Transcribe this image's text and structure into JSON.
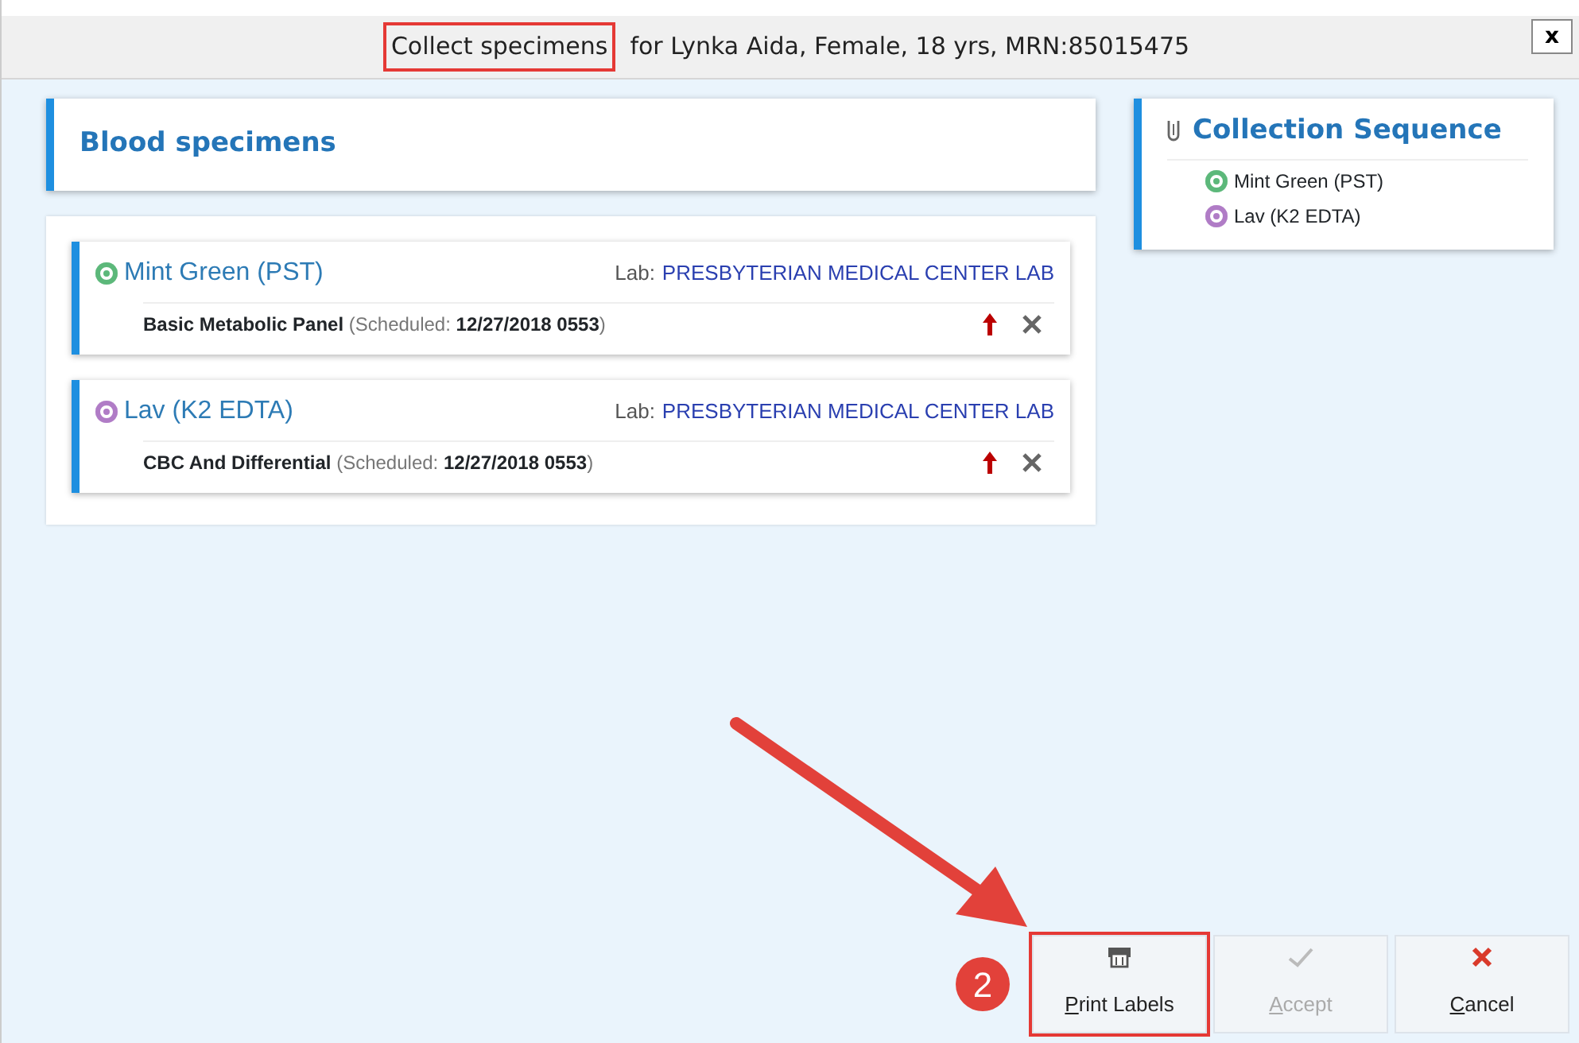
{
  "window": {
    "title_parts": [
      {
        "text": "Collect specimens",
        "highlighted": true
      },
      {
        "text": "for Lynka Aida, Female, 18 yrs,  MRN:85015475",
        "highlighted": false
      }
    ],
    "close": "x"
  },
  "specimens": {
    "title": "Blood specimens",
    "containers": [
      {
        "name": "Mint Green (PST)",
        "color": "#5cb87a",
        "lab_label": "Lab:",
        "lab": "PRESBYTERIAN MEDICAL CENTER LAB",
        "orders": [
          {
            "test": "Basic Metabolic Panel",
            "scheduled_label": "(Scheduled:",
            "scheduled": "12/27/2018 0553",
            "close_paren": ")"
          }
        ]
      },
      {
        "name": "Lav (K2 EDTA)",
        "color": "#b07cc6",
        "lab_label": "Lab:",
        "lab": "PRESBYTERIAN MEDICAL CENTER LAB",
        "orders": [
          {
            "test": "CBC And Differential",
            "scheduled_label": "(Scheduled:",
            "scheduled": "12/27/2018 0553",
            "close_paren": ")"
          }
        ]
      }
    ]
  },
  "sequence": {
    "title": "Collection Sequence",
    "items": [
      {
        "name": "Mint Green (PST)",
        "color": "#5cb87a"
      },
      {
        "name": "Lav (K2 EDTA)",
        "color": "#b07cc6"
      }
    ]
  },
  "buttons": [
    {
      "label": "Print Labels",
      "kind": "print",
      "disabled": false,
      "highlighted": true
    },
    {
      "label": "Accept",
      "kind": "accept",
      "disabled": true,
      "highlighted": false
    },
    {
      "label": "Cancel",
      "kind": "cancel",
      "disabled": false,
      "highlighted": false
    }
  ],
  "step_badge": "2"
}
